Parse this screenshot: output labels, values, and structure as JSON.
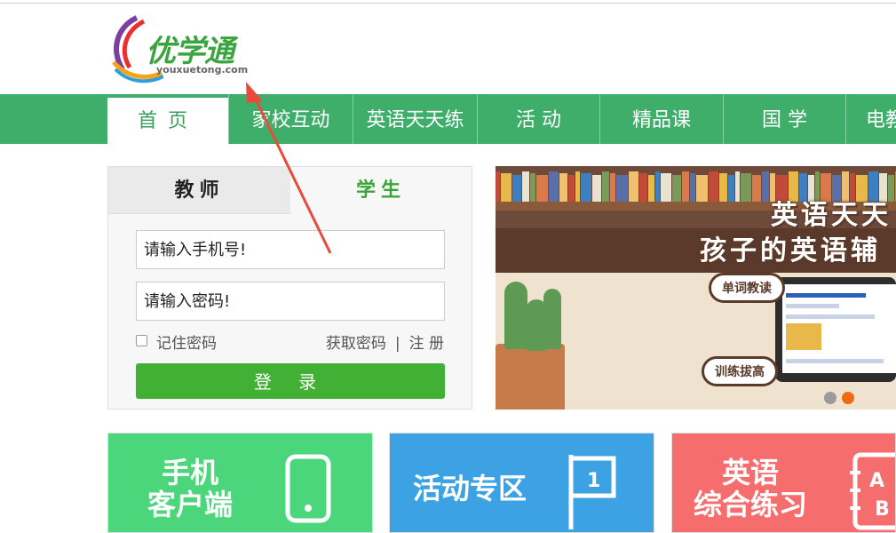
{
  "logo": {
    "name": "优学通",
    "domain": "youxuetong.com"
  },
  "nav": {
    "items": [
      "首页",
      "家校互动",
      "英语天天练",
      "活 动",
      "精品课",
      "国 学",
      "电教"
    ]
  },
  "login": {
    "tabs": {
      "teacher": "教师",
      "student": "学生"
    },
    "phone_placeholder": "请输入手机号!",
    "password_placeholder": "请输入密码!",
    "remember": "记住密码",
    "get_password": "获取密码",
    "separator": "|",
    "register": "注 册",
    "submit": "登 录"
  },
  "banner": {
    "title_line1": "英语天天",
    "title_line2": "孩子的英语辅",
    "bubble1": "单词教读",
    "bubble2": "训练拔高",
    "active_slide": 2,
    "slide_count": 2
  },
  "tiles": {
    "mobile": {
      "line1": "手机",
      "line2": "客户端"
    },
    "activity": {
      "label": "活动专区",
      "badge": "1"
    },
    "english": {
      "line1": "英语",
      "line2": "综合练习",
      "letters": "AB"
    }
  },
  "colors": {
    "nav_green": "#3fae6a",
    "login_green": "#42b035",
    "tile_green": "#4cd67c",
    "tile_blue": "#3da2e4",
    "tile_red": "#f56d6d",
    "arrow_red": "#e84b3c",
    "dot_active": "#f26a10"
  }
}
